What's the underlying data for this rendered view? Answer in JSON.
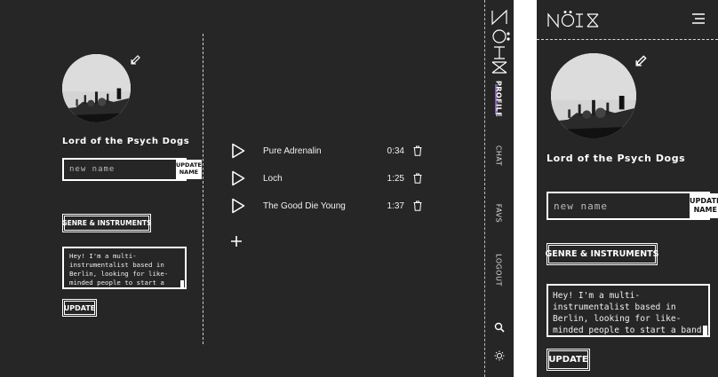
{
  "brand": {
    "logo": "NÖIX"
  },
  "profile": {
    "username": "Lord of the Psych Dogs",
    "name_input_placeholder": "new name",
    "update_name_label": "UPDATE NAME",
    "genre_button_label": "GENRE & INSTRUMENTS",
    "bio_text": "Hey! I'm a multi-instrumentalist based in Berlin, looking for like-minded people to start a band with.",
    "update_button_label": "UPDATE"
  },
  "tracks": [
    {
      "title": "Pure Adrenalin",
      "duration": "0:34"
    },
    {
      "title": "Loch",
      "duration": "1:25"
    },
    {
      "title": "The Good Die Young",
      "duration": "1:37"
    }
  ],
  "sidebar": {
    "items": [
      {
        "label": "PROFILE",
        "active": true
      },
      {
        "label": "CHAT",
        "active": false
      },
      {
        "label": "FAVS",
        "active": false
      },
      {
        "label": "LOGOUT",
        "active": false
      }
    ],
    "icons": [
      "search-icon",
      "sun-icon"
    ]
  },
  "colors": {
    "background": "#262626",
    "foreground": "#ffffff",
    "active_accent": "#7b5ea8"
  }
}
